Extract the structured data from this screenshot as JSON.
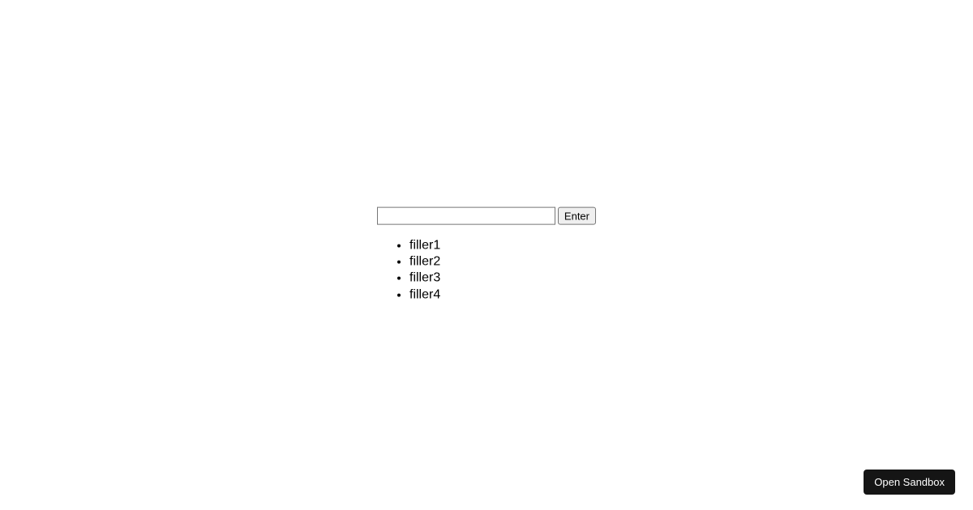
{
  "input": {
    "value": "",
    "placeholder": ""
  },
  "enter_button_label": "Enter",
  "items": [
    "filler1",
    "filler2",
    "filler3",
    "filler4"
  ],
  "open_sandbox_label": "Open Sandbox"
}
